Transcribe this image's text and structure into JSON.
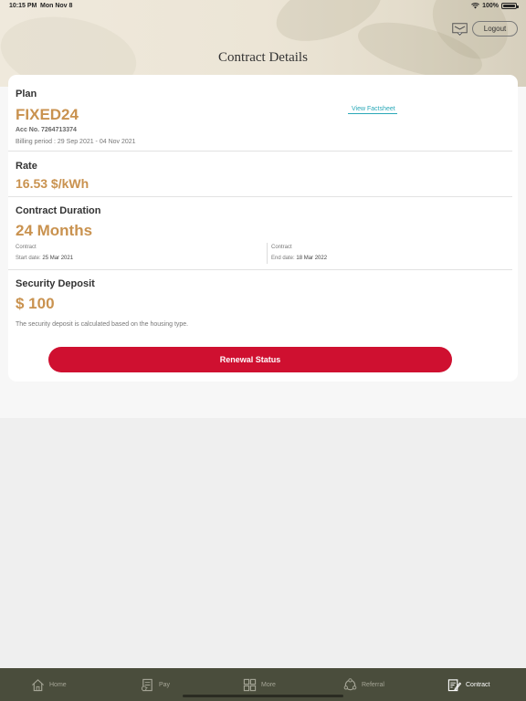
{
  "status_bar": {
    "time": "10:15 PM",
    "date": "Mon Nov 8",
    "battery": "100%"
  },
  "header": {
    "title": "Contract Details",
    "logout_label": "Logout"
  },
  "plan": {
    "heading": "Plan",
    "name": "FIXED24",
    "account": "Acc No. 7264713374",
    "billing_period": "Billing period : 29 Sep 2021 - 04 Nov 2021",
    "factsheet_link": "View Factsheet"
  },
  "rate": {
    "heading": "Rate",
    "value": "16.53 $/kWh"
  },
  "duration": {
    "heading": "Contract Duration",
    "value": "24 Months",
    "start_label": "Contract",
    "start_prefix": "Start date:",
    "start_date": "25 Mar 2021",
    "end_label": "Contract",
    "end_prefix": "End date:",
    "end_date": "18 Mar 2022"
  },
  "deposit": {
    "heading": "Security Deposit",
    "value": "$ 100",
    "note": "The security deposit is calculated based on the housing type."
  },
  "renewal_button": "Renewal Status",
  "tabs": [
    {
      "label": "Home",
      "icon": "home-icon",
      "active": false
    },
    {
      "label": "Pay",
      "icon": "pay-icon",
      "active": false
    },
    {
      "label": "More",
      "icon": "grid-icon",
      "active": false
    },
    {
      "label": "Referral",
      "icon": "referral-icon",
      "active": false
    },
    {
      "label": "Contract",
      "icon": "contract-icon",
      "active": true
    }
  ],
  "colors": {
    "accent_gold": "#c9924f",
    "button_red": "#cf1030",
    "link_teal": "#2aa8b8",
    "tabbar": "#4a4d3c"
  }
}
